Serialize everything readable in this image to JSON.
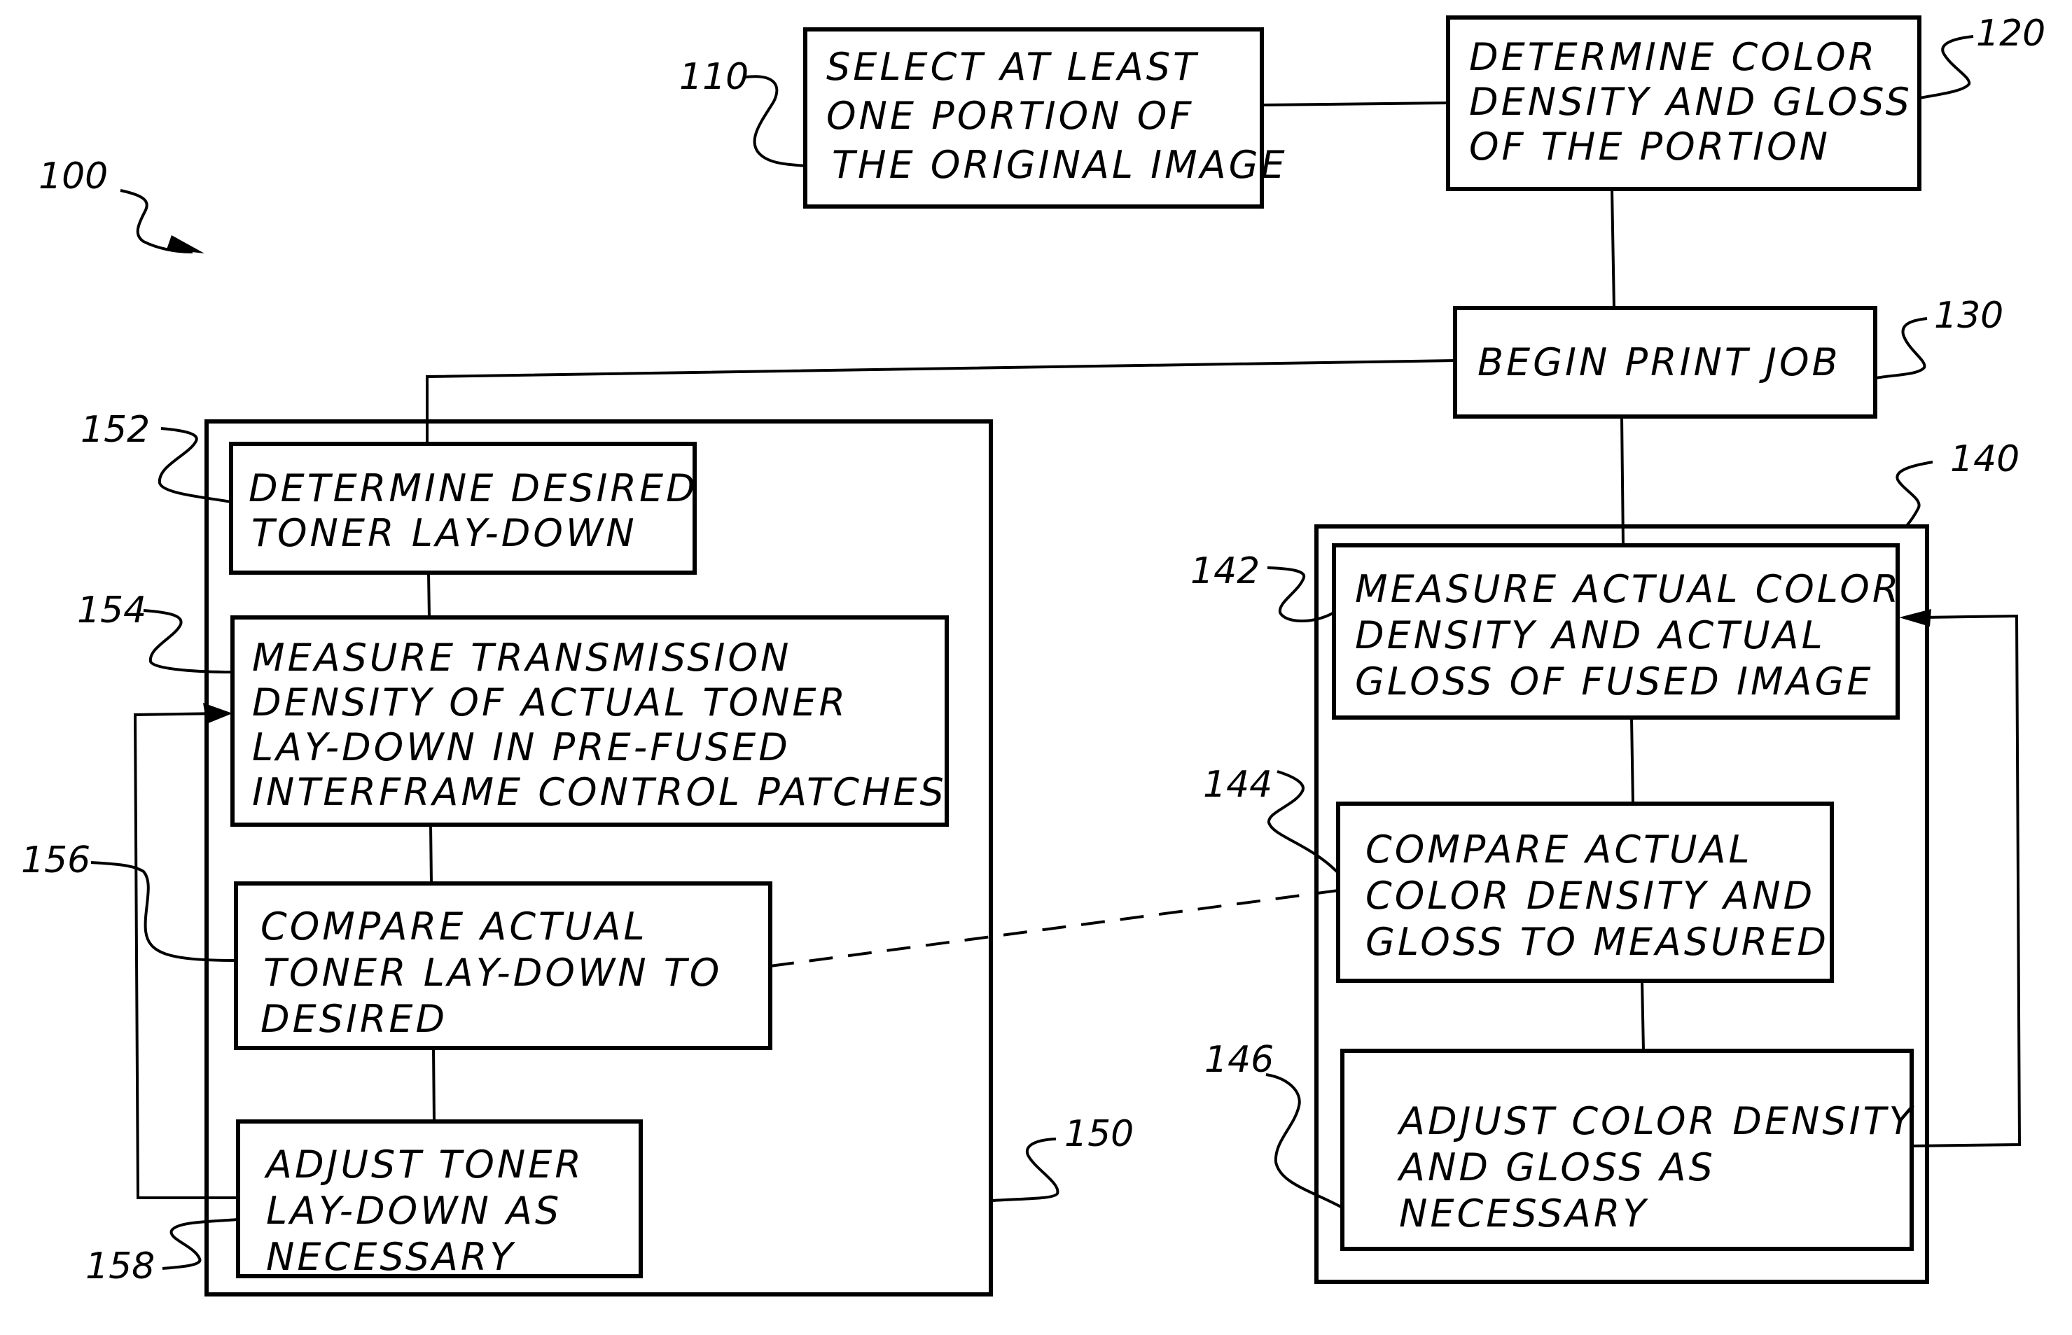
{
  "figure": {
    "reference": "100",
    "ink_color": "#000000",
    "background_color": "#ffffff"
  },
  "steps": {
    "s110": {
      "ref": "110",
      "lines": [
        "SELECT AT LEAST",
        "ONE PORTION OF",
        "THE ORIGINAL IMAGE"
      ]
    },
    "s120": {
      "ref": "120",
      "lines": [
        "DETERMINE COLOR",
        "DENSITY AND GLOSS",
        "OF THE PORTION"
      ]
    },
    "s130": {
      "ref": "130",
      "lines": [
        "BEGIN PRINT JOB"
      ]
    },
    "s140": {
      "ref": "140"
    },
    "s142": {
      "ref": "142",
      "lines": [
        "MEASURE ACTUAL COLOR",
        "DENSITY AND ACTUAL",
        "GLOSS OF FUSED IMAGE"
      ]
    },
    "s144": {
      "ref": "144",
      "lines": [
        "COMPARE ACTUAL",
        "COLOR DENSITY AND",
        "GLOSS TO MEASURED"
      ]
    },
    "s146": {
      "ref": "146",
      "lines": [
        "ADJUST COLOR DENSITY",
        "AND GLOSS AS",
        "NECESSARY"
      ]
    },
    "s150": {
      "ref": "150"
    },
    "s152": {
      "ref": "152",
      "lines": [
        "DETERMINE DESIRED",
        "TONER LAY-DOWN"
      ]
    },
    "s154": {
      "ref": "154",
      "lines": [
        "MEASURE TRANSMISSION",
        "DENSITY OF ACTUAL TONER",
        "LAY-DOWN IN PRE-FUSED",
        "INTERFRAME CONTROL PATCHES"
      ]
    },
    "s156": {
      "ref": "156",
      "lines": [
        "COMPARE ACTUAL",
        "TONER LAY-DOWN TO",
        "DESIRED"
      ]
    },
    "s158": {
      "ref": "158",
      "lines": [
        "ADJUST TONER",
        "LAY-DOWN AS",
        "NECESSARY"
      ]
    }
  }
}
